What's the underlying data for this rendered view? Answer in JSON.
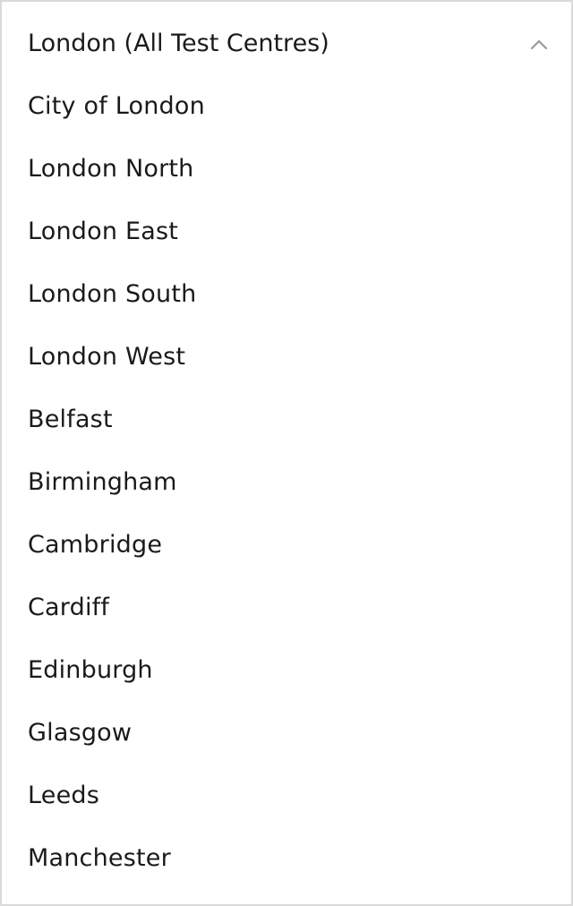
{
  "dropdown": {
    "selected_label": "London (All Test Centres)",
    "toggle_icon": "chevron-up-icon",
    "options": [
      "City of London",
      "London North",
      "London East",
      "London South",
      "London West",
      "Belfast",
      "Birmingham",
      "Cambridge",
      "Cardiff",
      "Edinburgh",
      "Glasgow",
      "Leeds",
      "Manchester"
    ]
  },
  "colors": {
    "border": "#d9d9d9",
    "text": "#1a1a1a",
    "icon": "#9a9a9a",
    "background": "#ffffff"
  }
}
